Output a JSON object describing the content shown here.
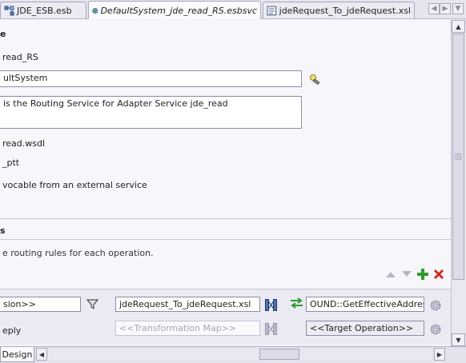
{
  "tabs": [
    {
      "label": "JDE_ESB.esb",
      "icon": "esb-diagram-icon",
      "active": false,
      "italic": false
    },
    {
      "label": "DefaultSystem_jde_read_RS.esbsvc",
      "icon": "esb-service-icon",
      "active": true,
      "italic": true
    },
    {
      "label": "jdeRequest_To_jdeRequest.xsl",
      "icon": "xsl-map-icon",
      "active": false,
      "italic": false
    }
  ],
  "general": {
    "section_header": "e",
    "name_value": "read_RS",
    "system_value": "ultSystem",
    "description_value": "is the Routing Service for Adapter Service jde_read",
    "wsdl_value": "read.wsdl",
    "porttype_value": "_ptt",
    "invocable_label": "vocable from an external service"
  },
  "routing": {
    "section_header": "s",
    "description": "e routing rules for each operation.",
    "row1": {
      "operation_value": "sion>>",
      "transformation_value": "jdeRequest_To_jdeRequest.xsl",
      "target_value": "OUND::GetEffectiveAddress"
    },
    "row2": {
      "label": "eply",
      "transformation_placeholder": "<<Transformation Map>>",
      "target_value": "<<Target Operation>>"
    }
  },
  "bottom": {
    "design_tab": "Design"
  }
}
